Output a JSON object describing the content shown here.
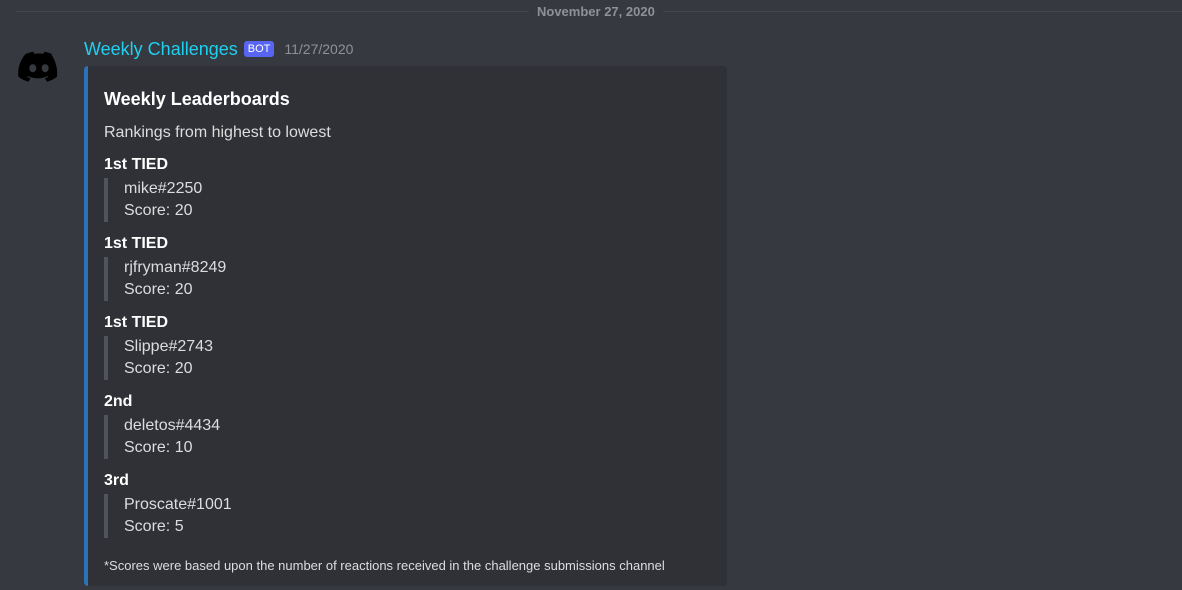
{
  "divider": {
    "date": "November 27, 2020"
  },
  "message": {
    "author": "Weekly Challenges",
    "bot_tag": "BOT",
    "timestamp": "11/27/2020",
    "avatar_icon": "discord-logo-icon"
  },
  "embed": {
    "accent_color": "#2a73bb",
    "title": "Weekly Leaderboards",
    "description": "Rankings from highest to lowest",
    "fields": [
      {
        "name": "1st TIED",
        "user": "mike#2250",
        "score": "Score: 20"
      },
      {
        "name": "1st TIED",
        "user": "rjfryman#8249",
        "score": "Score: 20"
      },
      {
        "name": "1st TIED",
        "user": "Slippe#2743",
        "score": "Score: 20"
      },
      {
        "name": "2nd",
        "user": "deletos#4434",
        "score": "Score: 10"
      },
      {
        "name": "3rd",
        "user": "Proscate#1001",
        "score": "Score: 5"
      }
    ],
    "footnote": "*Scores were based upon the number of reactions received in the challenge submissions channel"
  },
  "colors": {
    "background": "#36393f",
    "embed_background": "#2f3136",
    "username": "#1fd0f0",
    "bot_tag": "#5865f2"
  }
}
